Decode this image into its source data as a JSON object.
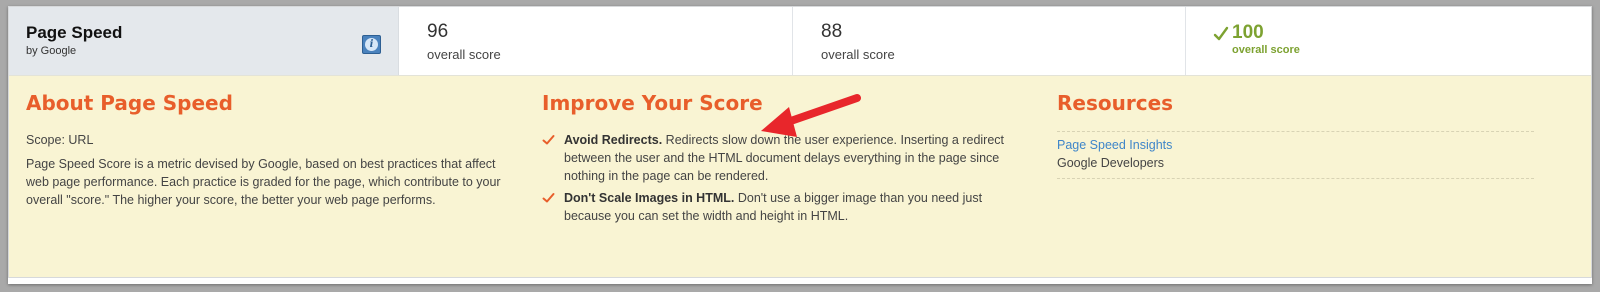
{
  "header": {
    "title": "Page Speed",
    "subtitle": "by Google",
    "info_icon": "info-icon",
    "scores": [
      {
        "value": "96",
        "label": "overall score"
      },
      {
        "value": "88",
        "label": "overall score"
      },
      {
        "value": "100",
        "label": "overall score",
        "best": true
      }
    ]
  },
  "about": {
    "heading": "About Page Speed",
    "scope": "Scope: URL",
    "description": "Page Speed Score is a metric devised by Google, based on best practices that affect web page performance. Each practice is graded for the page, which contribute to your overall \"score.\" The higher your score, the better your web page performs."
  },
  "improve": {
    "heading": "Improve Your Score",
    "tips": [
      {
        "title": "Avoid Redirects.",
        "text": " Redirects slow down the user experience. Inserting a redirect between the user and the HTML document delays everything in the page since nothing in the page can be rendered."
      },
      {
        "title": "Don't Scale Images in HTML.",
        "text": " Don't use a bigger image than you need just because you can set the width and height in HTML."
      }
    ]
  },
  "resources": {
    "heading": "Resources",
    "items": [
      {
        "link": "Page Speed Insights",
        "org": "Google Developers"
      }
    ]
  },
  "colors": {
    "accent": "#e85e2b",
    "best_score": "#7da231",
    "link": "#3f86c9",
    "panel_bg": "#f9f4d3",
    "arrow": "#e8262b"
  }
}
